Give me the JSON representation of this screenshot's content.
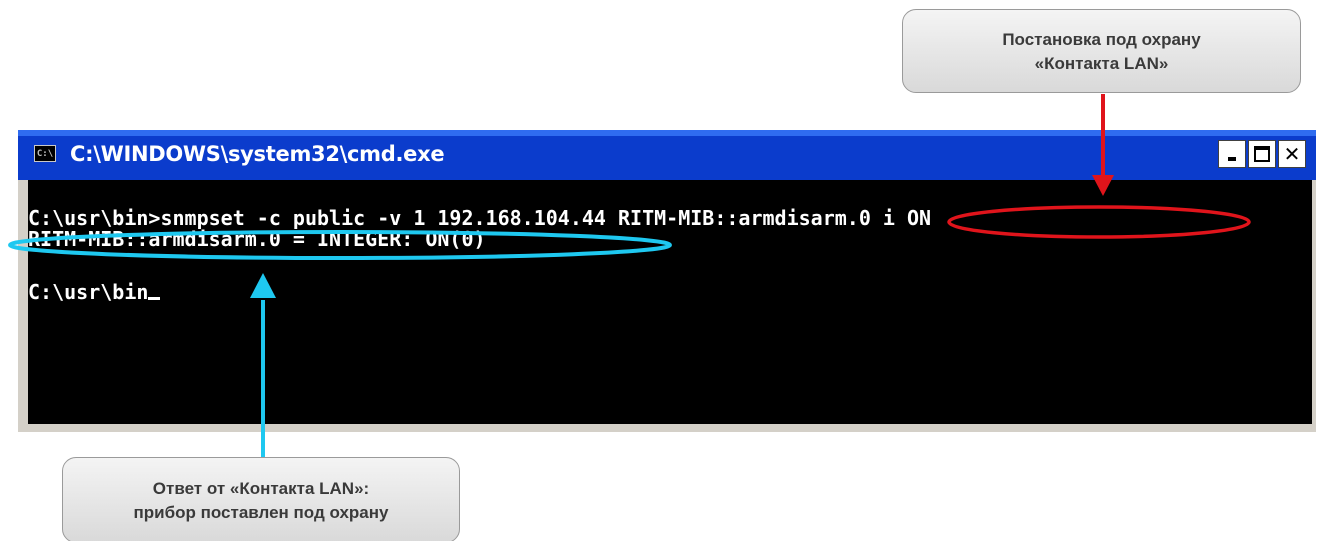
{
  "window": {
    "title": "C:\\WINDOWS\\system32\\cmd.exe",
    "icon": "cmd-icon",
    "icon_text": "C:\\"
  },
  "console": {
    "lines": [
      "C:\\usr\\bin>snmpset -c public -v 1 192.168.104.44 RITM-MIB::armdisarm.0 i ON",
      "RITM-MIB::armdisarm.0 = INTEGER: ON(0)",
      "C:\\usr\\bin"
    ]
  },
  "callouts": {
    "top": {
      "line1": "Постановка под охрану",
      "line2": "«Контакта LAN»"
    },
    "bottom": {
      "line1": "Ответ от  «Контакта LAN»:",
      "line2": "прибор поставлен под охрану"
    }
  },
  "colors": {
    "titlebar": "#0b3ccc",
    "arrow_red": "#e0141b",
    "arrow_cyan": "#1ec8f0",
    "highlight_red": "#e0141b",
    "highlight_cyan": "#1ec8f0"
  }
}
